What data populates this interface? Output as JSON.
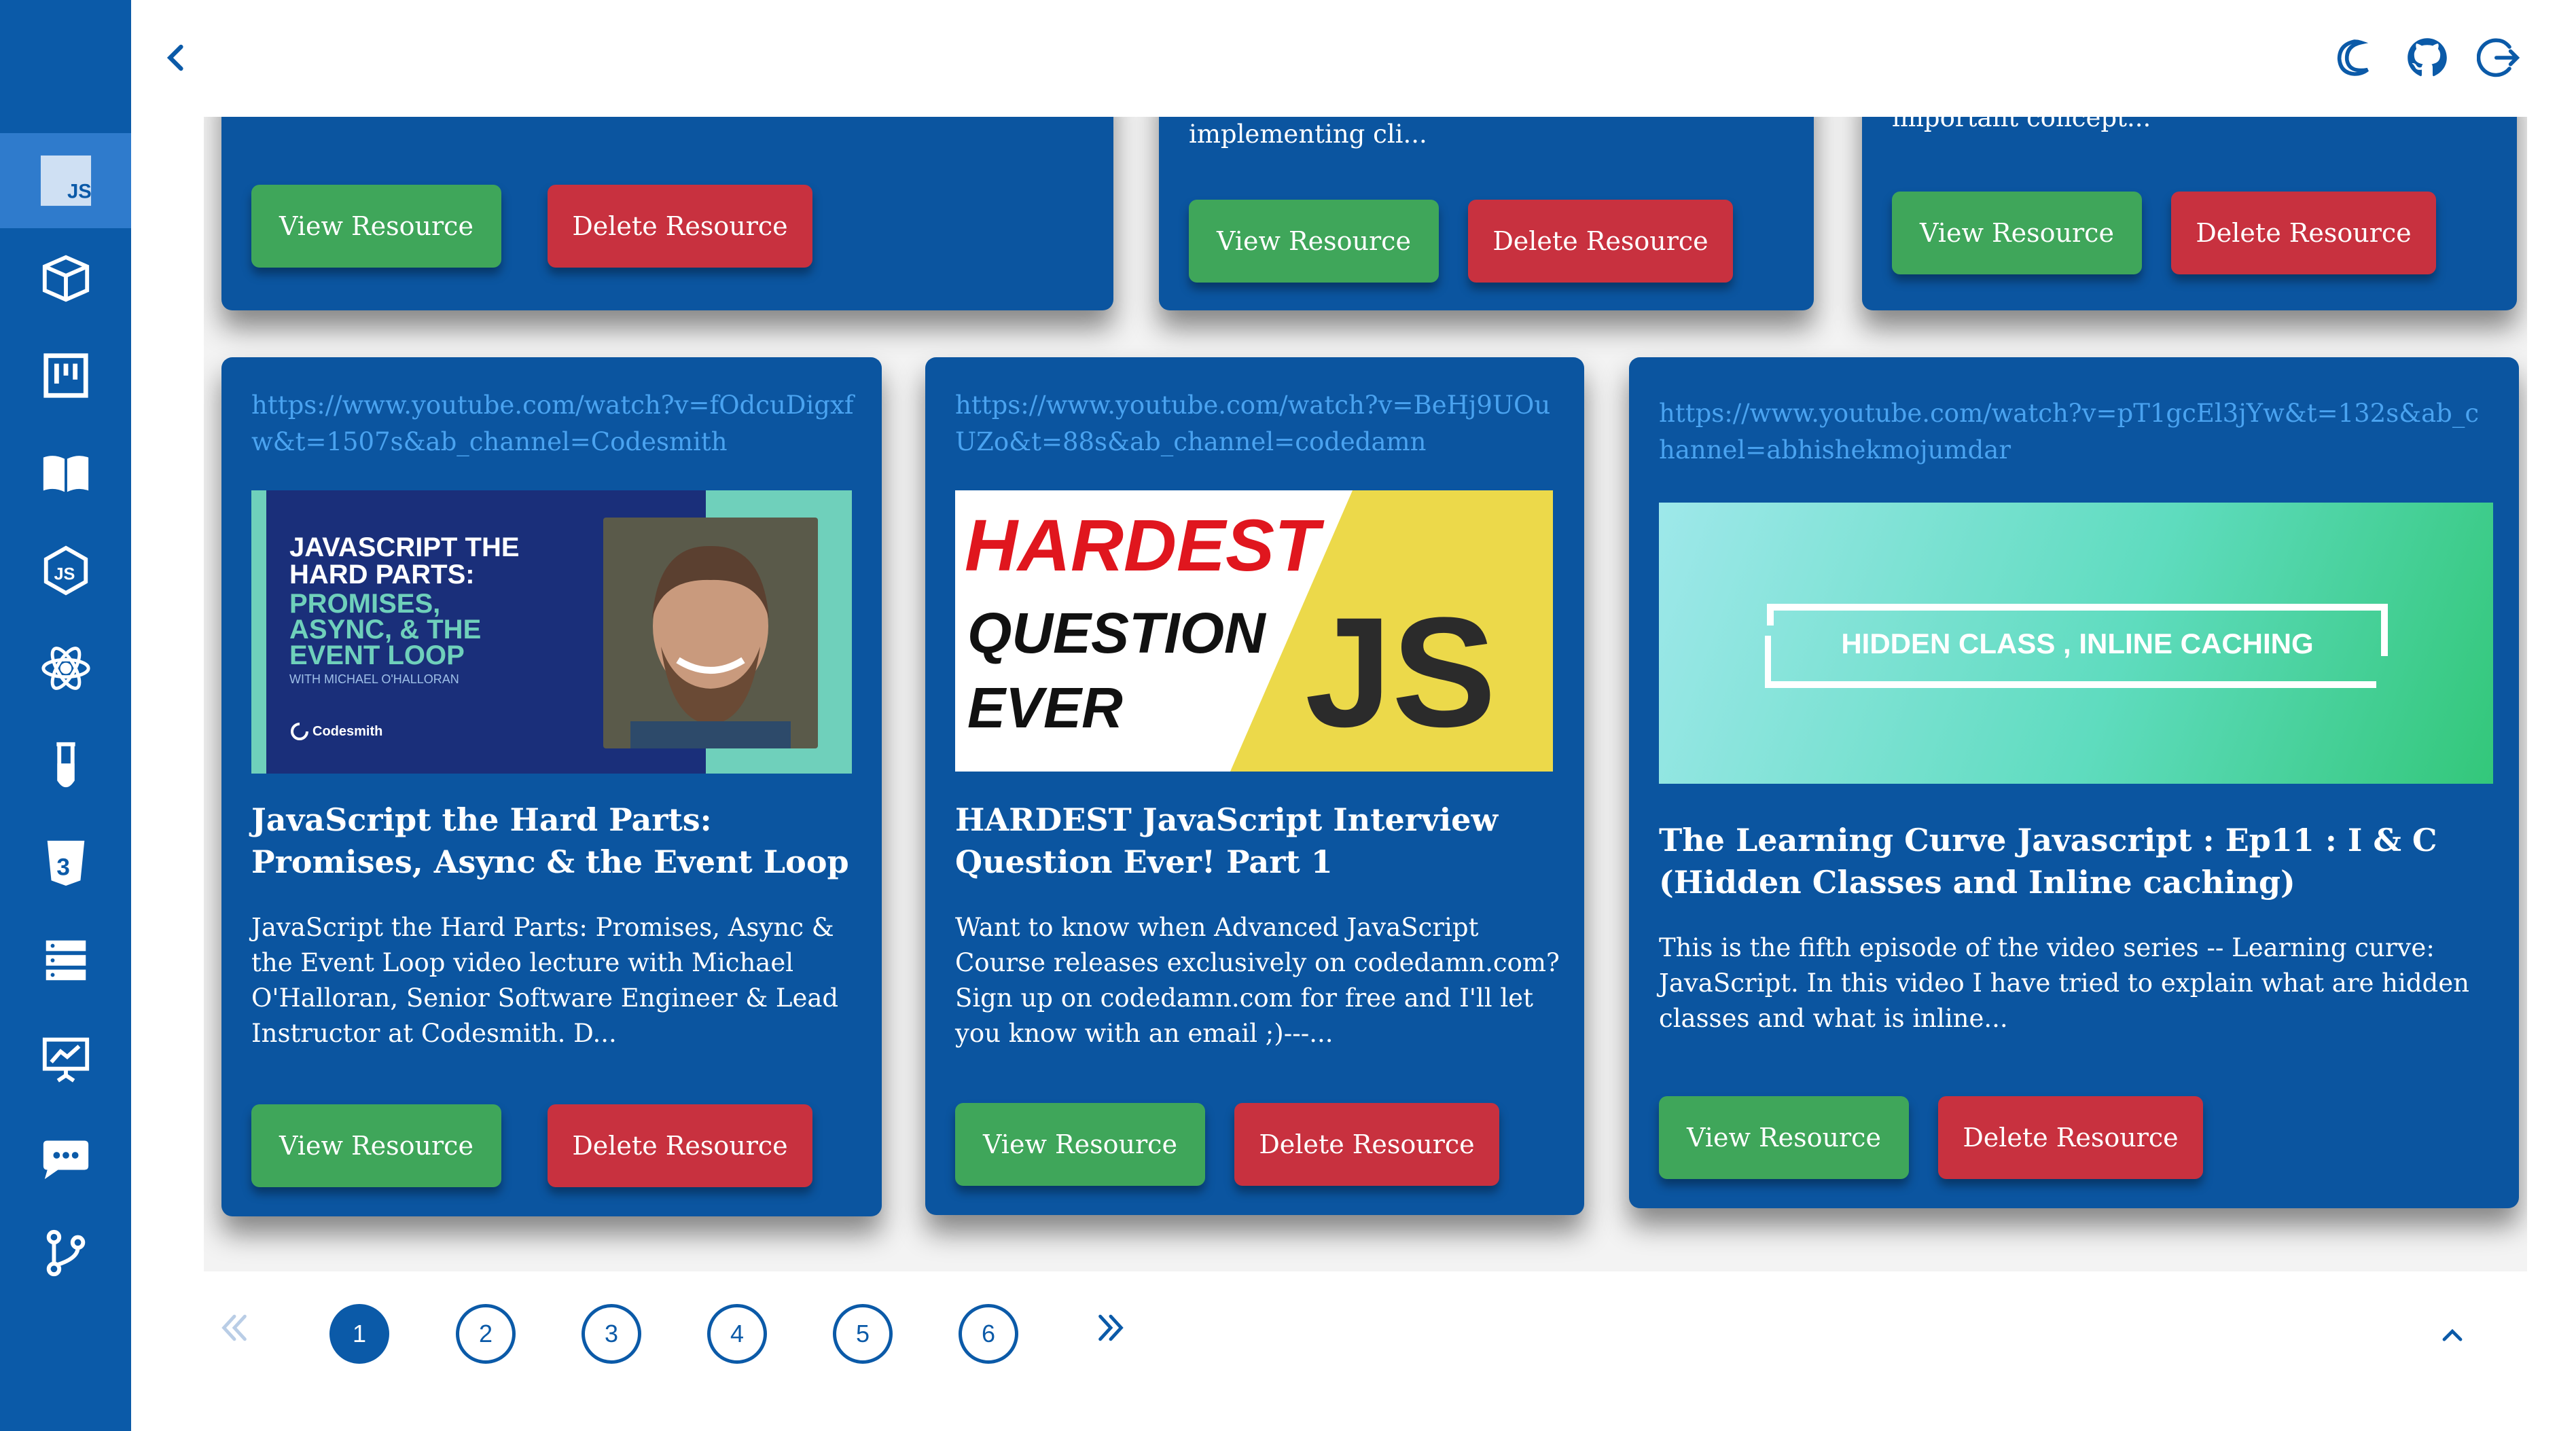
{
  "header": {
    "back_icon": "chevron-left-icon",
    "actions": [
      "moon-icon",
      "github-icon",
      "logout-icon"
    ]
  },
  "sidebar": {
    "items": [
      {
        "icon": "javascript-icon",
        "active": true
      },
      {
        "icon": "cube-icon"
      },
      {
        "icon": "kanban-icon"
      },
      {
        "icon": "open-book-icon"
      },
      {
        "icon": "nodejs-icon"
      },
      {
        "icon": "react-atom-icon"
      },
      {
        "icon": "test-tube-icon"
      },
      {
        "icon": "css3-icon"
      },
      {
        "icon": "server-stack-icon"
      },
      {
        "icon": "presentation-chart-icon"
      },
      {
        "icon": "chat-bubble-icon"
      },
      {
        "icon": "git-branch-icon"
      }
    ]
  },
  "top_cards": [
    {
      "desc_tail": "",
      "view_label": "View Resource",
      "delete_label": "Delete Resource"
    },
    {
      "desc_tail": "implementing cli...",
      "view_label": "View Resource",
      "delete_label": "Delete Resource"
    },
    {
      "desc_tail": "important concept...",
      "view_label": "View Resource",
      "delete_label": "Delete Resource"
    }
  ],
  "cards": [
    {
      "url": "https://www.youtube.com/watch?v=fOdcuDigxfw&t=1507s&ab_channel=Codesmith",
      "thumb": {
        "heading_1": "JAVASCRIPT THE",
        "heading_2": "HARD PARTS:",
        "heading_3": "PROMISES,",
        "heading_4": "ASYNC, & THE",
        "heading_5": "EVENT LOOP",
        "byline": "WITH MICHAEL O'HALLORAN",
        "brand": "Codesmith"
      },
      "title": "JavaScript the Hard Parts: Promises, Async & the Event Loop",
      "description": "JavaScript the Hard Parts: Promises, Async & the Event Loop video lecture with Michael O'Halloran, Senior Software Engineer & Lead Instructor at Codesmith. D...",
      "view_label": "View Resource",
      "delete_label": "Delete Resource"
    },
    {
      "url": "https://www.youtube.com/watch?v=BeHj9UOuUZo&t=88s&ab_channel=codedamn",
      "thumb": {
        "line_1": "HARDEST",
        "line_2": "QUESTION",
        "line_3": "EVER",
        "logo": "JS"
      },
      "title": "HARDEST JavaScript Interview Question Ever! Part 1",
      "description": "Want to know when Advanced JavaScript Course releases exclusively on codedamn.com? Sign up on codedamn.com for free and I'll let you know with an email ;)---...",
      "view_label": "View Resource",
      "delete_label": "Delete Resource"
    },
    {
      "url": "https://www.youtube.com/watch?v=pT1gcEl3jYw&t=132s&ab_channel=abhishekmojumdar",
      "thumb": {
        "caption": "HIDDEN CLASS , INLINE CACHING"
      },
      "title": "The Learning Curve Javascript : Ep11 : I & C (Hidden Classes and Inline caching)",
      "description": "This is the fifth episode of the video series -- Learning curve: JavaScript. In this video I have tried to explain what are hidden classes and what is inline...",
      "view_label": "View Resource",
      "delete_label": "Delete Resource"
    }
  ],
  "pagination": {
    "pages": [
      "1",
      "2",
      "3",
      "4",
      "5",
      "6"
    ],
    "current": "1",
    "prev_icon": "double-chevron-left-icon",
    "next_icon": "double-chevron-right-icon",
    "scroll_top_icon": "chevron-up-icon"
  },
  "colors": {
    "sidebar": "#0b5aa8",
    "card": "#0b55a0",
    "link": "#4aa3f0",
    "view_button": "#3fa65a",
    "delete_button": "#c8313f"
  }
}
